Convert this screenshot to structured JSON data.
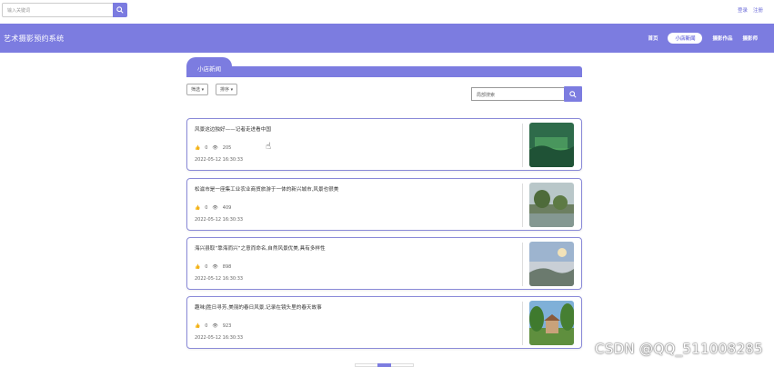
{
  "topbar": {
    "search_placeholder": "输入关键词",
    "login_label": "登录",
    "register_label": "注册"
  },
  "header": {
    "title": "艺术摄影预约系统",
    "nav": [
      {
        "label": "首页",
        "active": false
      },
      {
        "label": "小店新闻",
        "active": true
      },
      {
        "label": "摄影作品",
        "active": false
      },
      {
        "label": "摄影师",
        "active": false
      }
    ]
  },
  "section": {
    "title": "小店新闻"
  },
  "filters": {
    "filter_label": "筛选 ▾",
    "sort_label": "排序 ▾",
    "local_search_placeholder": "局部搜索"
  },
  "news": [
    {
      "title": "风景这边独好——记者走进看中国",
      "likes": "0",
      "views": "205",
      "date": "2022-05-12 16:30:33"
    },
    {
      "title": "松滋市是一座集工业农业商贸旅游于一体的新兴城市,风景也很美",
      "likes": "0",
      "views": "409",
      "date": "2022-05-12 16:30:33"
    },
    {
      "title": "海兴县取“靠海而兴”之意而命名,自然风景优美,具有多样性",
      "likes": "0",
      "views": "898",
      "date": "2022-05-12 16:30:33"
    },
    {
      "title": "趣味|胜日寻芳,美丽的春日风景,记录在镜头里的春天故事",
      "likes": "0",
      "views": "923",
      "date": "2022-05-12 16:30:33"
    }
  ],
  "watermark": "CSDN @QQ_511008285",
  "colors": {
    "accent": "#7c7ce0"
  }
}
